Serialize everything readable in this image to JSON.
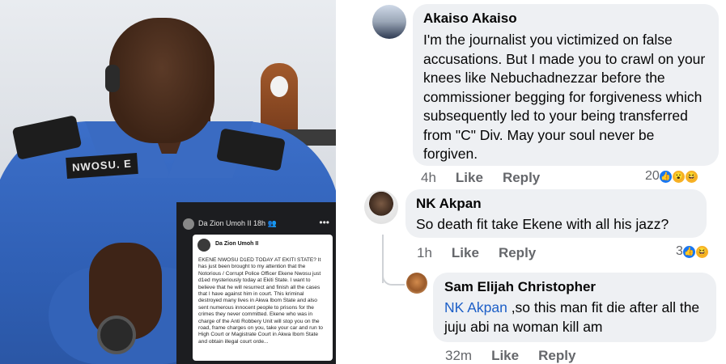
{
  "photo": {
    "nametag": "NWOSU. E"
  },
  "embedded_post": {
    "top_author": "Da Zion Umoh II",
    "top_time": "18h",
    "menu": "•••",
    "card_author": "Da Zion Umoh II",
    "card_text": "EKENE NWOSU D1ED TODAY AT EKITI STATE? It has just been brought to my attention that the Notorious / Corrupt Police Officer Ekene Nwosu just d1ed mysteriously today at Ekiti State. I want to believe that he will resurrect and finish all the cases that I have against him in court. This kriminal destroyed many lives in Akwa Ibom State and also sent numerous innocent people to prisons for the crimes they never committed. Ekene who was in charge of the Anti Robbery Unit will stop you on the road, frame charges on you, take your car and run to High Court or Magistrate Court in Akwa Ibom State and obtain illegal court orde..."
  },
  "comments": [
    {
      "author": "Akaiso Akaiso",
      "text": "I'm the journalist you victimized on false accusations. But I made you to crawl on your knees like Nebuchadnezzar before the commissioner begging for forgiveness which subsequently led to your being transferred from \"C\" Div. May your soul never be forgiven.",
      "time": "4h",
      "like": "Like",
      "reply": "Reply",
      "reaction_count": "20"
    },
    {
      "author": "NK Akpan",
      "text": "So death fit take Ekene with all his jazz?",
      "time": "1h",
      "like": "Like",
      "reply": "Reply",
      "reaction_count": "3"
    },
    {
      "author": "Sam Elijah Christopher",
      "mention": "NK Akpan",
      "text": " ,so this man fit die after all the juju abi na woman kill am",
      "time": "32m",
      "like": "Like",
      "reply": "Reply"
    }
  ],
  "icons": {
    "like_reaction": "like-icon",
    "wow_reaction": "wow-icon",
    "haha_reaction": "haha-icon"
  },
  "colors": {
    "bubble": "#eef0f3",
    "mention": "#1d5fc7",
    "meta": "#65676b",
    "like_blue": "#1877f2"
  }
}
